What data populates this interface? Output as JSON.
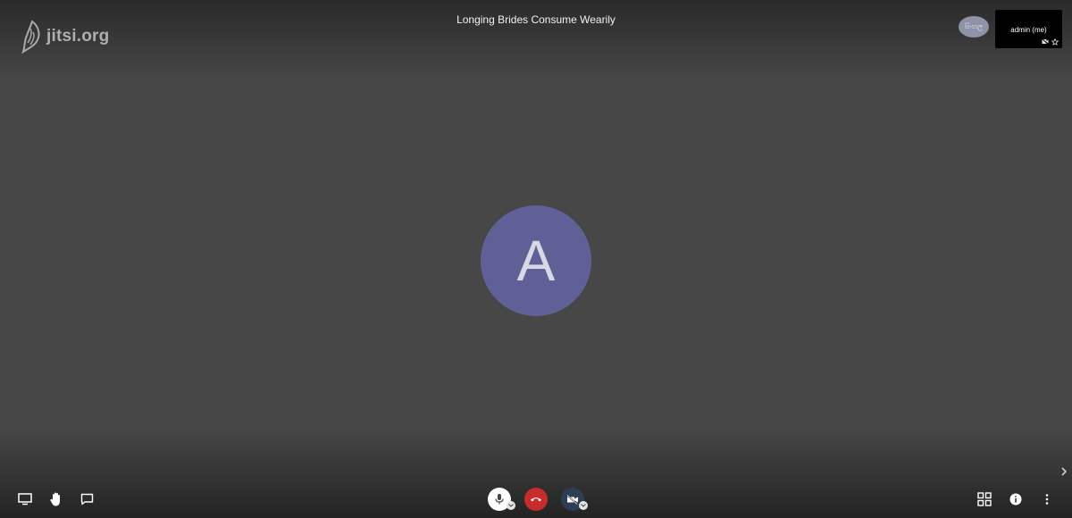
{
  "logo": {
    "text": "jitsi.org"
  },
  "meeting": {
    "title": "Longing Brides Consume Wearily"
  },
  "remote_participant": {
    "label": "සිංහල"
  },
  "local_tile": {
    "name": "admin (me)"
  },
  "main_avatar": {
    "initial": "A",
    "color": "#5f6196"
  },
  "toolbar": {
    "left": [
      "screen-share-icon",
      "raise-hand-icon",
      "chat-icon"
    ],
    "center": [
      "microphone-icon",
      "hangup-icon",
      "camera-off-icon"
    ],
    "right": [
      "tile-view-icon",
      "info-icon",
      "more-options-icon"
    ]
  },
  "colors": {
    "background": "#474747",
    "hangup": "#c62c2c",
    "mic": "#ffffff",
    "camera": "#2e3e52"
  }
}
